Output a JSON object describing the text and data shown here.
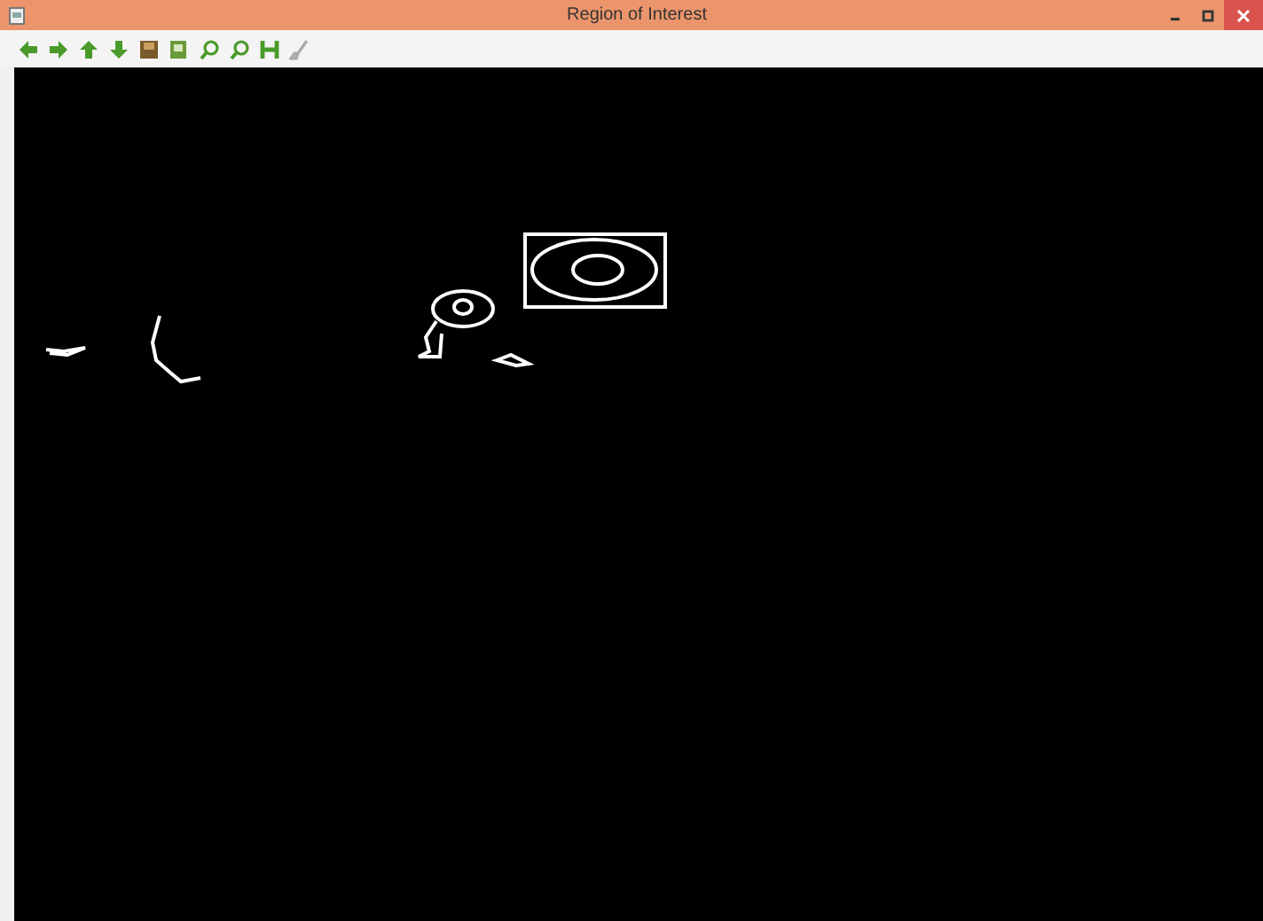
{
  "window": {
    "title": "Region of Interest"
  }
}
